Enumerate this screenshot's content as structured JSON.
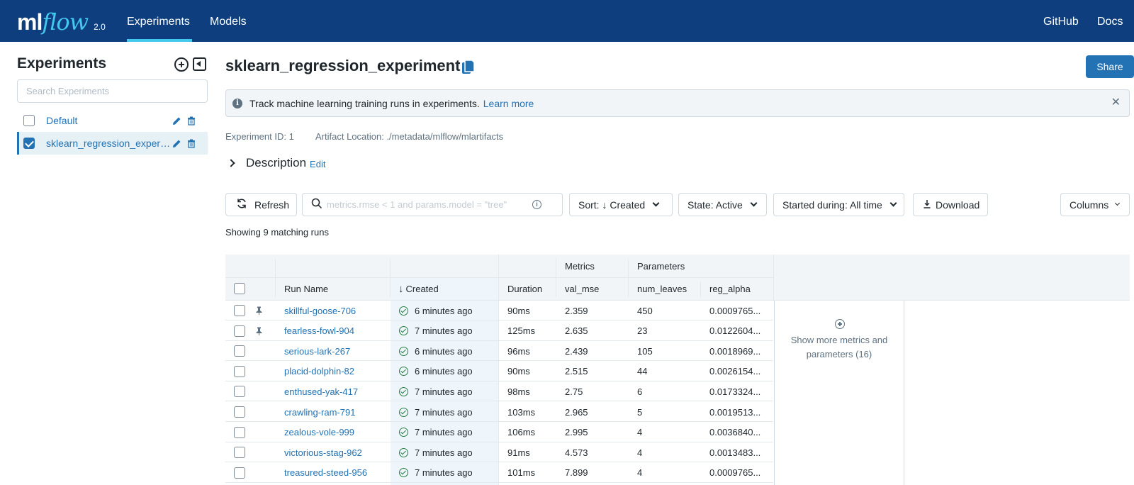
{
  "nav": {
    "logo_ml": "ml",
    "logo_flow": "flow",
    "version": "2.0",
    "links": [
      "Experiments",
      "Models"
    ],
    "right_links": [
      "GitHub",
      "Docs"
    ]
  },
  "sidebar": {
    "title": "Experiments",
    "search_placeholder": "Search Experiments",
    "items": [
      {
        "label": "Default",
        "checked": false
      },
      {
        "label": "sklearn_regression_experiment",
        "checked": true
      }
    ]
  },
  "main": {
    "title": "sklearn_regression_experiment",
    "share_label": "Share",
    "banner": {
      "text": "Track machine learning training runs in experiments.",
      "link": "Learn more"
    },
    "experiment_id": "Experiment ID: 1",
    "artifact_location": "Artifact Location: ./metadata/mlflow/mlartifacts",
    "description_label": "Description",
    "description_edit": "Edit"
  },
  "controls": {
    "refresh": "Refresh",
    "search_placeholder": "metrics.rmse < 1 and params.model = \"tree\"",
    "sort": "Sort: ↓ Created",
    "state": "State: Active",
    "started": "Started during: All time",
    "download": "Download",
    "columns": "Columns"
  },
  "showing": "Showing 9 matching runs",
  "table": {
    "group_headers": {
      "metrics": "Metrics",
      "parameters": "Parameters"
    },
    "headers": {
      "run_name": "Run Name",
      "created": "Created",
      "duration": "Duration",
      "val_mse": "val_mse",
      "num_leaves": "num_leaves",
      "reg_alpha": "reg_alpha"
    },
    "rows": [
      {
        "pinned": true,
        "name": "skillful-goose-706",
        "created": "6 minutes ago",
        "duration": "90ms",
        "val_mse": "2.359",
        "num_leaves": "450",
        "reg_alpha": "0.0009765..."
      },
      {
        "pinned": true,
        "name": "fearless-fowl-904",
        "created": "7 minutes ago",
        "duration": "125ms",
        "val_mse": "2.635",
        "num_leaves": "23",
        "reg_alpha": "0.0122604..."
      },
      {
        "pinned": false,
        "name": "serious-lark-267",
        "created": "6 minutes ago",
        "duration": "96ms",
        "val_mse": "2.439",
        "num_leaves": "105",
        "reg_alpha": "0.0018969..."
      },
      {
        "pinned": false,
        "name": "placid-dolphin-82",
        "created": "6 minutes ago",
        "duration": "90ms",
        "val_mse": "2.515",
        "num_leaves": "44",
        "reg_alpha": "0.0026154..."
      },
      {
        "pinned": false,
        "name": "enthused-yak-417",
        "created": "7 minutes ago",
        "duration": "98ms",
        "val_mse": "2.75",
        "num_leaves": "6",
        "reg_alpha": "0.0173324..."
      },
      {
        "pinned": false,
        "name": "crawling-ram-791",
        "created": "7 minutes ago",
        "duration": "103ms",
        "val_mse": "2.965",
        "num_leaves": "5",
        "reg_alpha": "0.0019513..."
      },
      {
        "pinned": false,
        "name": "zealous-vole-999",
        "created": "7 minutes ago",
        "duration": "106ms",
        "val_mse": "2.995",
        "num_leaves": "4",
        "reg_alpha": "0.0036840..."
      },
      {
        "pinned": false,
        "name": "victorious-stag-962",
        "created": "7 minutes ago",
        "duration": "91ms",
        "val_mse": "4.573",
        "num_leaves": "4",
        "reg_alpha": "0.0013483..."
      },
      {
        "pinned": false,
        "name": "treasured-steed-956",
        "created": "7 minutes ago",
        "duration": "101ms",
        "val_mse": "7.899",
        "num_leaves": "4",
        "reg_alpha": "0.0009765..."
      }
    ],
    "show_more": "Show more metrics and parameters (16)"
  },
  "colors": {
    "nav_bg": "#0e3e7d",
    "accent": "#2272b4",
    "logo_flow": "#43c9ed",
    "success": "#277c43"
  }
}
